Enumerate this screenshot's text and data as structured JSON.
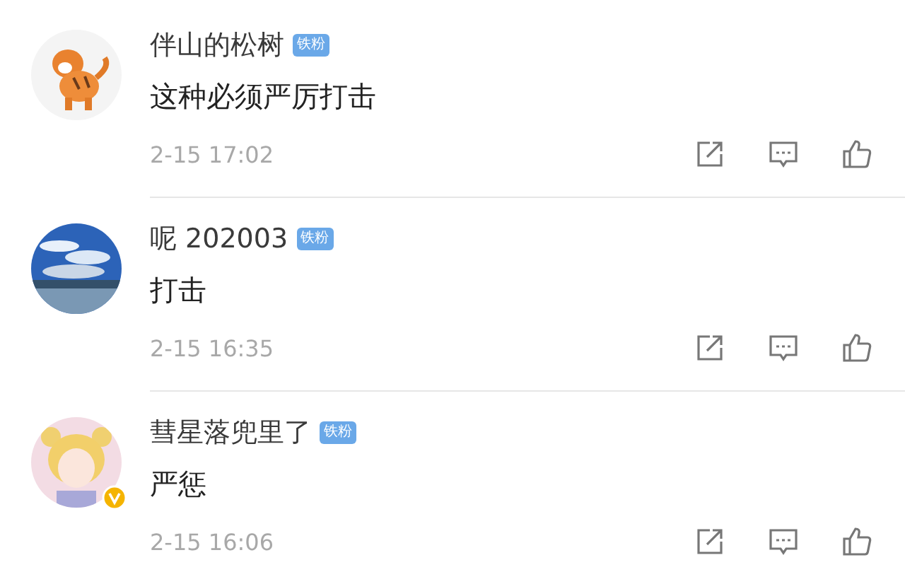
{
  "comments": [
    {
      "user": "伴山的松树",
      "badge": "铁粉",
      "verified": false,
      "avatar": {
        "kind": "cartoon"
      },
      "text": "这种必须严厉打击",
      "time": "2-15 17:02"
    },
    {
      "user": "呢 202003",
      "badge": "铁粉",
      "verified": false,
      "text": "打击",
      "time": "2-15 16:35"
    },
    {
      "user": "彗星落兜里了",
      "badge": "铁粉",
      "verified": true,
      "avatar": {
        "kind": "illustration"
      },
      "text": "严惩",
      "time": "2-15 16:06"
    }
  ]
}
